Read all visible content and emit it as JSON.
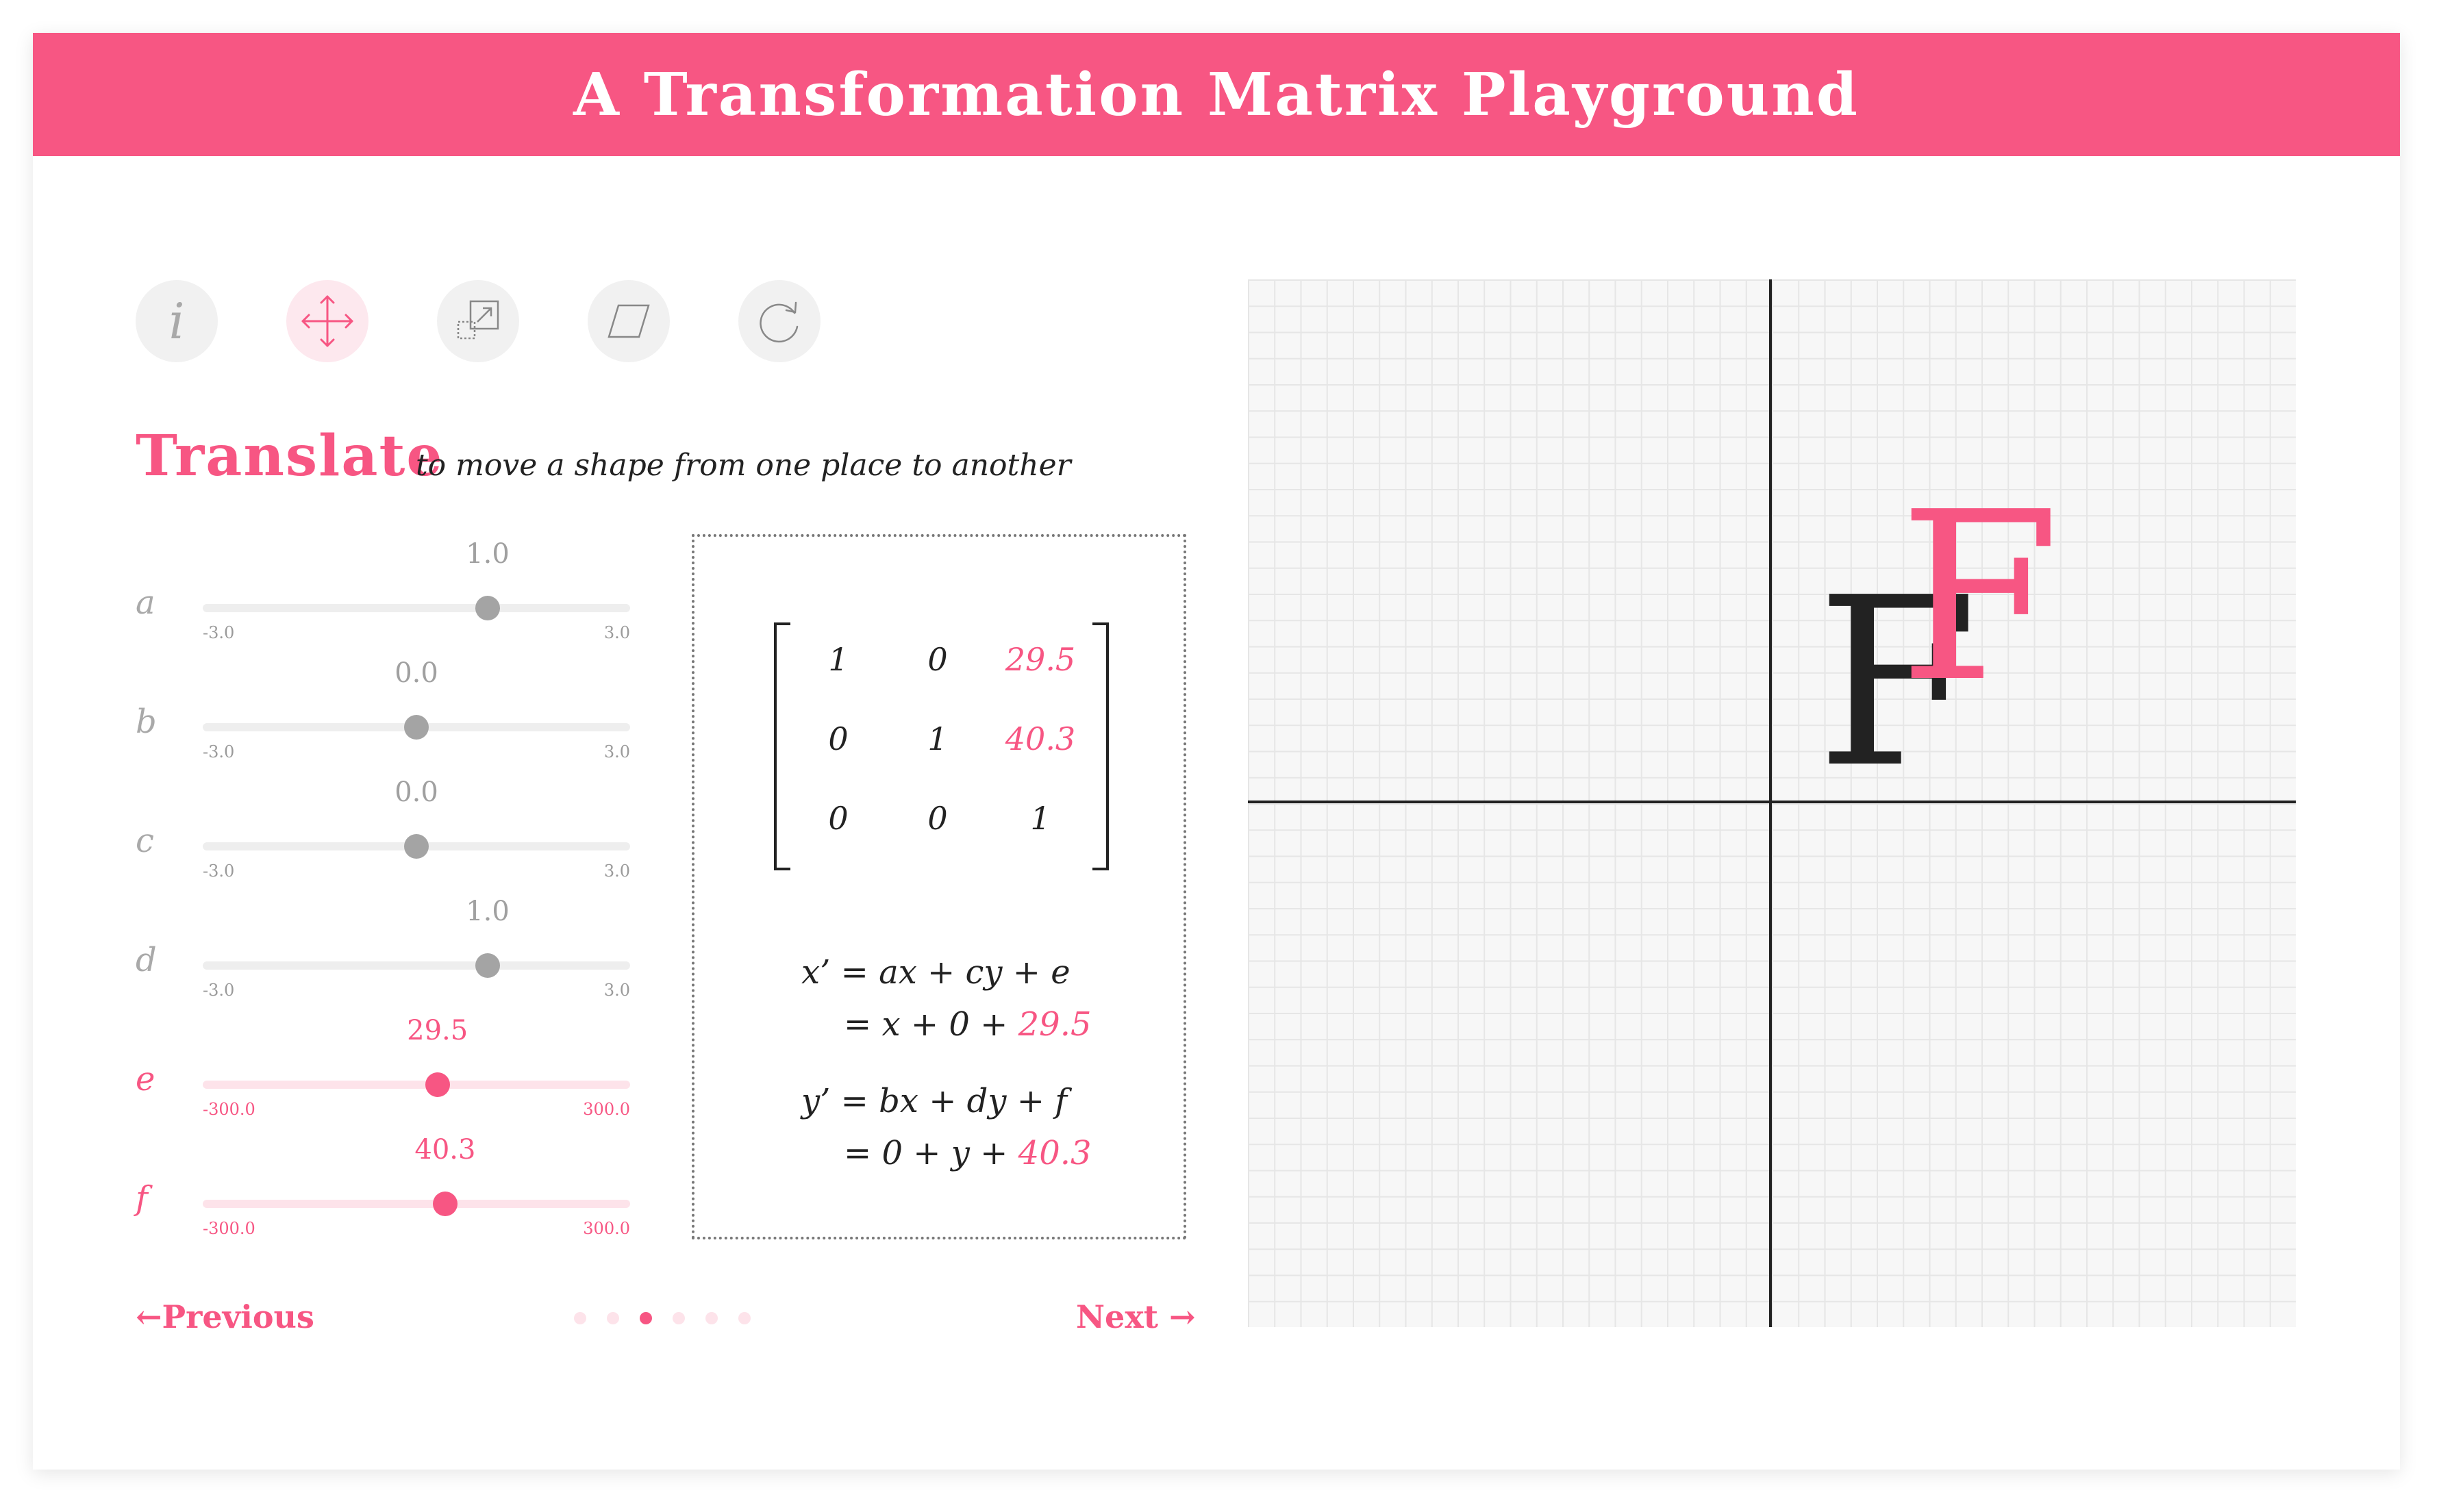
{
  "header": {
    "title": "A Transformation Matrix Playground"
  },
  "toolbar": {
    "icons": [
      {
        "name": "info-icon",
        "glyph": "i",
        "active": false
      },
      {
        "name": "translate-icon",
        "active": true
      },
      {
        "name": "scale-icon",
        "active": false
      },
      {
        "name": "skew-icon",
        "active": false
      },
      {
        "name": "rotate-icon",
        "active": false
      }
    ]
  },
  "section": {
    "title": "Translate",
    "description": "to move a shape from one place to another"
  },
  "sliders": [
    {
      "label": "a",
      "value": "1.0",
      "numeric": 1.0,
      "min": "-3.0",
      "max": "3.0",
      "min_n": -3,
      "max_n": 3,
      "highlight": false
    },
    {
      "label": "b",
      "value": "0.0",
      "numeric": 0.0,
      "min": "-3.0",
      "max": "3.0",
      "min_n": -3,
      "max_n": 3,
      "highlight": false
    },
    {
      "label": "c",
      "value": "0.0",
      "numeric": 0.0,
      "min": "-3.0",
      "max": "3.0",
      "min_n": -3,
      "max_n": 3,
      "highlight": false
    },
    {
      "label": "d",
      "value": "1.0",
      "numeric": 1.0,
      "min": "-3.0",
      "max": "3.0",
      "min_n": -3,
      "max_n": 3,
      "highlight": false
    },
    {
      "label": "e",
      "value": "29.5",
      "numeric": 29.5,
      "min": "-300.0",
      "max": "300.0",
      "min_n": -300,
      "max_n": 300,
      "highlight": true
    },
    {
      "label": "f",
      "value": "40.3",
      "numeric": 40.3,
      "min": "-300.0",
      "max": "300.0",
      "min_n": -300,
      "max_n": 300,
      "highlight": true
    }
  ],
  "matrix": {
    "rows": [
      [
        "1",
        "0",
        "29.5"
      ],
      [
        "0",
        "1",
        "40.3"
      ],
      [
        "0",
        "0",
        "1"
      ]
    ]
  },
  "equations": {
    "x_formula": {
      "lhs": "x’",
      "eq": "=",
      "t1": "ax",
      "p1": "+",
      "t2": "cy",
      "p2": "+",
      "t3": "e"
    },
    "x_values": {
      "eq": "=",
      "t1": "x",
      "p1": "+",
      "t2": "0",
      "p2": "+",
      "t3": "29.5"
    },
    "y_formula": {
      "lhs": "y’",
      "eq": "=",
      "t1": "bx",
      "p1": "+",
      "t2": "dy",
      "p2": "+",
      "t3": "f"
    },
    "y_values": {
      "eq": "=",
      "t1": "0",
      "p1": "+",
      "t2": "y",
      "p2": "+",
      "t3": "40.3"
    }
  },
  "navigation": {
    "previous": "←Previous",
    "next": "Next →",
    "pages": 6,
    "current_page": 3
  },
  "canvas": {
    "original_letter": "F",
    "transformed_letter": "F",
    "colors": {
      "accent": "#f75683",
      "ink": "#222222"
    }
  }
}
